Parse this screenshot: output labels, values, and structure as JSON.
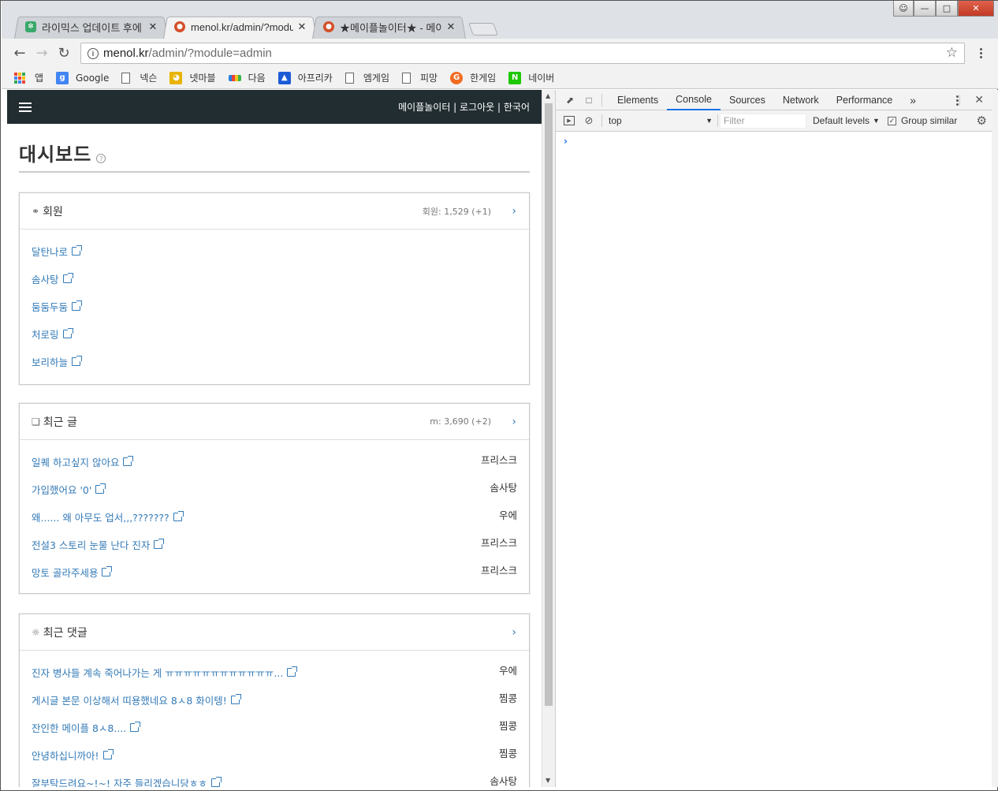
{
  "browser": {
    "tabs": [
      {
        "title": "라이믹스 업데이트 후에",
        "active": false,
        "icon_color": "#3aa86b"
      },
      {
        "title": "menol.kr/admin/?module",
        "active": true,
        "icon_color": "#d4502a"
      },
      {
        "title": "★메이플놀이터★ - 메이",
        "active": false,
        "icon_color": "#d4502a"
      }
    ],
    "url_host": "menol.kr",
    "url_path": "/admin/?module=admin",
    "bookmarks": [
      {
        "label": "앱",
        "icon": "apps-icon"
      },
      {
        "label": "Google",
        "icon": "google-icon",
        "color": "#4285f4"
      },
      {
        "label": "넥슨",
        "icon": "doc-icon"
      },
      {
        "label": "넷마블",
        "icon": "netmarble-icon",
        "color": "#e8b400"
      },
      {
        "label": "다음",
        "icon": "daum-icon"
      },
      {
        "label": "아프리카",
        "icon": "afreeca-icon",
        "color": "#1b5bd6"
      },
      {
        "label": "엠게임",
        "icon": "doc-icon"
      },
      {
        "label": "피망",
        "icon": "doc-icon"
      },
      {
        "label": "한게임",
        "icon": "hangame-icon",
        "color": "#f26b21"
      },
      {
        "label": "네이버",
        "icon": "naver-icon",
        "color": "#1ec800"
      }
    ]
  },
  "admin": {
    "header_links": "메이플놀이터 | 로그아웃 | 한국어",
    "page_title": "대시보드",
    "members": {
      "title": "회원",
      "meta": "회원: 1,529 (+1)",
      "items": [
        "달탄나로",
        "솜사탕",
        "둠둠두둠",
        "처로링",
        "보리하늘"
      ]
    },
    "posts": {
      "title": "최근 글",
      "meta": "m: 3,690 (+2)",
      "items": [
        {
          "text": "일퀘 하고싶지 않아요",
          "author": "프리스크"
        },
        {
          "text": "가입했어요 '0'",
          "author": "솜사탕"
        },
        {
          "text": "왜...... 왜 아무도 업서,,,???????",
          "author": "우에"
        },
        {
          "text": "전설3 스토리 눈물 난다 진자",
          "author": "프리스크"
        },
        {
          "text": "망토 골라주세용",
          "author": "프리스크"
        }
      ]
    },
    "comments": {
      "title": "최근 댓글",
      "items": [
        {
          "text": "진자 병사들 계속 죽어나가는 게 ㅠㅠㅠㅠㅠㅠㅠㅠㅠㅠㅠㅠ...",
          "author": "우에"
        },
        {
          "text": "게시글 본문 이상해서 띠용했네요 8ㅅ8 화이텡!",
          "author": "찜콩"
        },
        {
          "text": "잔인한 메이플 8ㅅ8....",
          "author": "찜콩"
        },
        {
          "text": "안녕하십니까아!",
          "author": "찜콩"
        },
        {
          "text": "잘부탁드려요~!~! 자주 들리겠습니당ㅎㅎ",
          "author": "솜사탕"
        }
      ]
    }
  },
  "devtools": {
    "tabs": [
      "Elements",
      "Console",
      "Sources",
      "Network",
      "Performance"
    ],
    "active_tab": "Console",
    "more": "»",
    "context": "top",
    "filter_placeholder": "Filter",
    "levels": "Default levels",
    "group_similar": "Group similar",
    "prompt": "›"
  },
  "colors": {
    "accent": "#337ab7",
    "nav_bg": "#222d32",
    "devtools_active": "#1a73e8"
  }
}
